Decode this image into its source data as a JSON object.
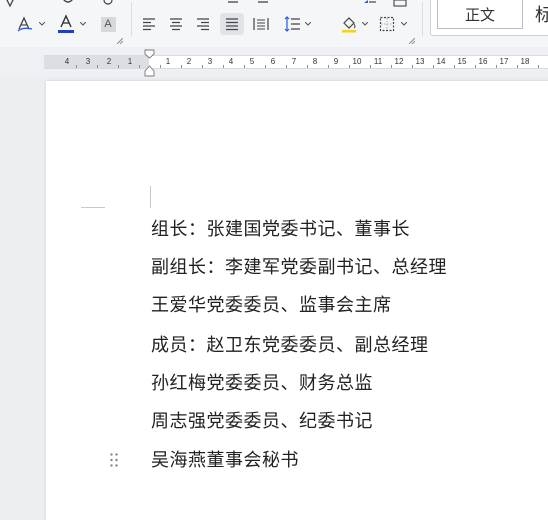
{
  "ribbon": {
    "styles": {
      "normal_label": "正文",
      "next_label": "标"
    },
    "char_shading_label": "A"
  },
  "ruler": {
    "left_numbers": [
      "4",
      "3",
      "2",
      "1"
    ],
    "right_numbers": [
      "1",
      "2",
      "3",
      "4",
      "5",
      "6",
      "7",
      "8",
      "9",
      "10",
      "11",
      "12",
      "13",
      "14",
      "15",
      "16",
      "17",
      "18"
    ]
  },
  "document": {
    "paragraphs": [
      "组长：张建国党委书记、董事长",
      "副组长：李建军党委副书记、总经理",
      "王爱华党委委员、监事会主席",
      "成员：赵卫东党委委员、副总经理",
      "孙红梅党委委员、财务总监",
      "周志强党委委员、纪委书记",
      "吴海燕董事会秘书"
    ]
  },
  "colors": {
    "font_color_bar": "#1f3fbf",
    "highlight_bar": "#f2d21a",
    "page": "#ffffff"
  },
  "icons": [
    "font-color-icon",
    "highlight-icon",
    "char-shading-icon",
    "align-left-icon",
    "align-center-icon",
    "align-right-icon",
    "justify-icon",
    "distributed-icon",
    "line-spacing-icon",
    "fill-color-icon",
    "border-icon"
  ]
}
